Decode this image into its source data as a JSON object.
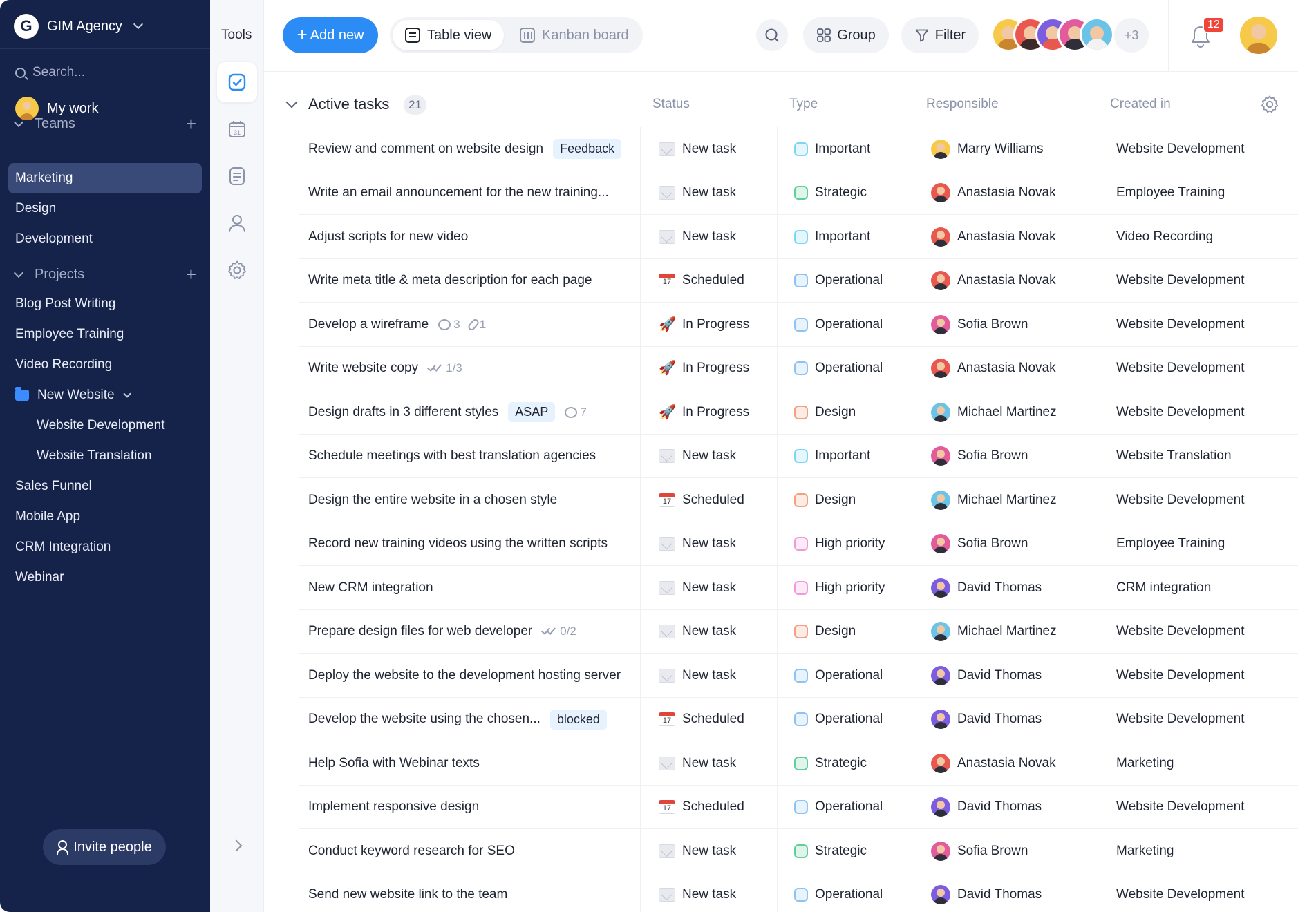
{
  "workspace": {
    "logo_letter": "G",
    "name": "GIM Agency"
  },
  "sidebar": {
    "search_placeholder": "Search...",
    "my_work": "My work",
    "teams_label": "Teams",
    "teams": [
      "Marketing",
      "Design",
      "Development"
    ],
    "projects_label": "Projects",
    "projects": [
      "Blog Post Writing",
      "Employee Training",
      "Video Recording"
    ],
    "folder": {
      "name": "New Website",
      "children": [
        "Website Development",
        "Website Translation"
      ]
    },
    "more_projects": [
      "Sales Funnel",
      "Mobile App",
      "CRM Integration",
      "Webinar"
    ],
    "invite": "Invite people"
  },
  "tools": {
    "title": "Tools"
  },
  "toolbar": {
    "add_new": "Add new",
    "table_view": "Table view",
    "kanban_board": "Kanban board",
    "group": "Group",
    "filter": "Filter",
    "more_members": "+3",
    "notifications": "12"
  },
  "table": {
    "group_title": "Active tasks",
    "count": "21",
    "columns": {
      "status": "Status",
      "type": "Type",
      "responsible": "Responsible",
      "created_in": "Created in"
    },
    "rows": [
      {
        "task": "Review and comment on website design",
        "tag": "Feedback",
        "status": "New task",
        "status_icon": "envelope",
        "type": "Important",
        "type_color": "#7dd6ef",
        "responsible": "Marry Williams",
        "avatar": "#f7c948",
        "project": "Website Development"
      },
      {
        "task": "Write an email announcement for the new training...",
        "status": "New task",
        "status_icon": "envelope",
        "type": "Strategic",
        "type_color": "#5fcf9a",
        "responsible": "Anastasia Novak",
        "avatar": "#e8584f",
        "project": "Employee Training"
      },
      {
        "task": "Adjust scripts for new video",
        "status": "New task",
        "status_icon": "envelope",
        "type": "Important",
        "type_color": "#7dd6ef",
        "responsible": "Anastasia Novak",
        "avatar": "#e8584f",
        "project": "Video Recording"
      },
      {
        "task": "Write meta title & meta description for each page",
        "status": "Scheduled",
        "status_icon": "calendar",
        "type": "Operational",
        "type_color": "#8cc3f2",
        "responsible": "Anastasia Novak",
        "avatar": "#e8584f",
        "project": "Website Development"
      },
      {
        "task": "Develop a wireframe",
        "comments": "3",
        "attachments": "1",
        "status": "In Progress",
        "status_icon": "rocket",
        "type": "Operational",
        "type_color": "#8cc3f2",
        "responsible": "Sofia Brown",
        "avatar": "#e25c9b",
        "project": "Website Development"
      },
      {
        "task": "Write website copy",
        "checklist": "1/3",
        "status": "In Progress",
        "status_icon": "rocket",
        "type": "Operational",
        "type_color": "#8cc3f2",
        "responsible": "Anastasia Novak",
        "avatar": "#e8584f",
        "project": "Website Development"
      },
      {
        "task": "Design drafts in 3 different styles",
        "tag": "ASAP",
        "comments": "7",
        "status": "In Progress",
        "status_icon": "rocket",
        "type": "Design",
        "type_color": "#f2a07f",
        "responsible": "Michael Martinez",
        "avatar": "#6cc3e8",
        "project": "Website Development"
      },
      {
        "task": "Schedule meetings with best translation agencies",
        "status": "New task",
        "status_icon": "envelope",
        "type": "Important",
        "type_color": "#7dd6ef",
        "responsible": "Sofia Brown",
        "avatar": "#e25c9b",
        "project": "Website Translation"
      },
      {
        "task": "Design the entire website in a chosen style",
        "status": "Scheduled",
        "status_icon": "calendar",
        "type": "Design",
        "type_color": "#f2a07f",
        "responsible": "Michael Martinez",
        "avatar": "#6cc3e8",
        "project": "Website Development"
      },
      {
        "task": "Record new training videos using the written scripts",
        "status": "New task",
        "status_icon": "envelope",
        "type": "High priority",
        "type_color": "#ee9ad8",
        "responsible": "Sofia Brown",
        "avatar": "#e25c9b",
        "project": "Employee Training"
      },
      {
        "task": "New CRM integration",
        "status": "New task",
        "status_icon": "envelope",
        "type": "High priority",
        "type_color": "#ee9ad8",
        "responsible": "David Thomas",
        "avatar": "#7b5de0",
        "project": "CRM integration"
      },
      {
        "task": "Prepare design files for web developer",
        "checklist": "0/2",
        "status": "New task",
        "status_icon": "envelope",
        "type": "Design",
        "type_color": "#f2a07f",
        "responsible": "Michael Martinez",
        "avatar": "#6cc3e8",
        "project": "Website Development"
      },
      {
        "task": "Deploy the website to the development hosting server",
        "status": "New task",
        "status_icon": "envelope",
        "type": "Operational",
        "type_color": "#8cc3f2",
        "responsible": "David Thomas",
        "avatar": "#7b5de0",
        "project": "Website Development"
      },
      {
        "task": "Develop the website using the chosen...",
        "tag": "blocked",
        "status": "Scheduled",
        "status_icon": "calendar",
        "type": "Operational",
        "type_color": "#8cc3f2",
        "responsible": "David Thomas",
        "avatar": "#7b5de0",
        "project": "Website Development"
      },
      {
        "task": "Help Sofia with Webinar texts",
        "status": "New task",
        "status_icon": "envelope",
        "type": "Strategic",
        "type_color": "#5fcf9a",
        "responsible": "Anastasia Novak",
        "avatar": "#e8584f",
        "project": "Marketing"
      },
      {
        "task": "Implement responsive design",
        "status": "Scheduled",
        "status_icon": "calendar",
        "type": "Operational",
        "type_color": "#8cc3f2",
        "responsible": "David Thomas",
        "avatar": "#7b5de0",
        "project": "Website Development"
      },
      {
        "task": "Conduct keyword research for SEO",
        "status": "New task",
        "status_icon": "envelope",
        "type": "Strategic",
        "type_color": "#5fcf9a",
        "responsible": "Sofia Brown",
        "avatar": "#e25c9b",
        "project": "Marketing"
      },
      {
        "task": "Send new website link to the team",
        "status": "New task",
        "status_icon": "envelope",
        "type": "Operational",
        "type_color": "#8cc3f2",
        "responsible": "David Thomas",
        "avatar": "#7b5de0",
        "project": "Website Development"
      }
    ]
  },
  "colors": {
    "sidebar_bg": "#15224a",
    "accent": "#2a8cf4",
    "active_nav": "#3a4a78",
    "badge": "#f0453a"
  },
  "member_avatar_colors": [
    "#f7c948",
    "#e8584f",
    "#7b5de0",
    "#e25c9b",
    "#6cc3e8"
  ]
}
